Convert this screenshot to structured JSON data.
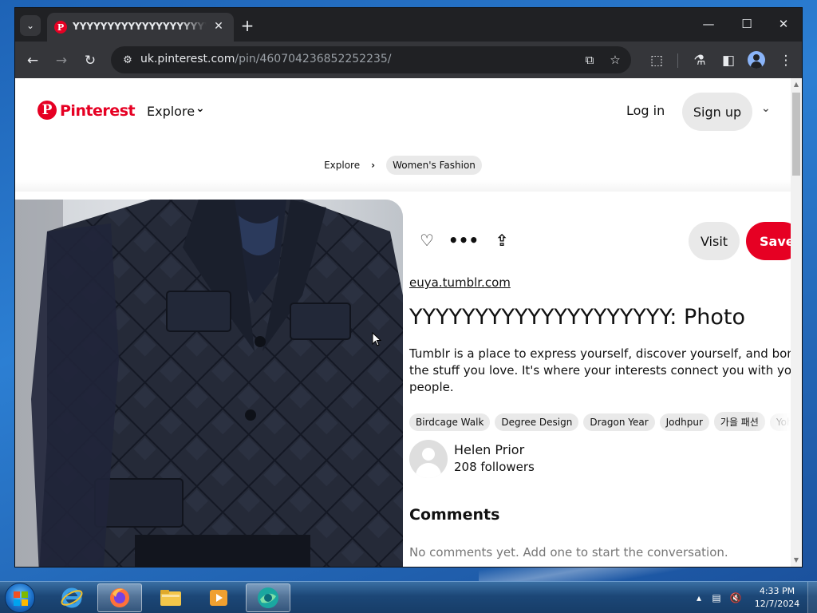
{
  "browser": {
    "tab": {
      "title": "YYYYYYYYYYYYYYYYYYYY: Photo"
    },
    "url": {
      "host": "uk.pinterest.com",
      "path": "/pin/460704236852252235/"
    }
  },
  "page": {
    "header": {
      "logo_text": "Pinterest",
      "explore_label": "Explore",
      "login_label": "Log in",
      "signup_label": "Sign up"
    },
    "breadcrumb": {
      "items": [
        "Explore",
        "Women's Fashion"
      ]
    },
    "pin": {
      "visit_label": "Visit",
      "save_label": "Save",
      "source": "euya.tumblr.com",
      "title": "YYYYYYYYYYYYYYYYYYYY: Photo",
      "description_line1": "Tumblr is a place to express yourself, discover yourself, and bond over",
      "description_line2": "the stuff you love. It's where your interests connect you with your",
      "description_line3": "people.",
      "tags": [
        "Birdcage Walk",
        "Degree Design",
        "Dragon Year",
        "Jodhpur",
        "가을 패션",
        "Yohji Yamamoto"
      ],
      "author": {
        "name": "Helen Prior",
        "followers": "208 followers"
      },
      "comments_heading": "Comments",
      "comments_empty": "No comments yet. Add one to start the conversation."
    }
  },
  "taskbar": {
    "time": "4:33 PM",
    "date": "12/7/2024"
  },
  "colors": {
    "pinterest_red": "#e60023",
    "chrome_dark": "#202124",
    "chrome_toolbar": "#35363a"
  }
}
